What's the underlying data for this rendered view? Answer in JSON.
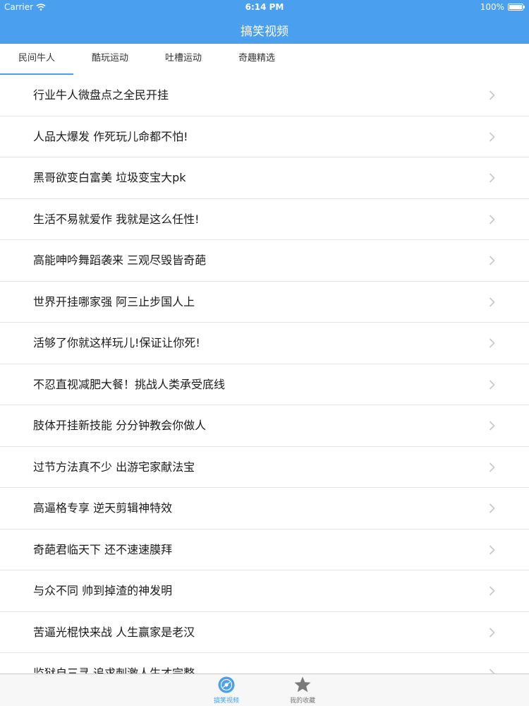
{
  "status_bar": {
    "carrier": "Carrier",
    "time": "6:14 PM",
    "battery": "100%"
  },
  "nav": {
    "title": "搞笑视频"
  },
  "tabs": [
    {
      "label": "民间牛人",
      "active": true
    },
    {
      "label": "酷玩运动",
      "active": false
    },
    {
      "label": "吐槽运动",
      "active": false
    },
    {
      "label": "奇趣精选",
      "active": false
    }
  ],
  "list": {
    "items": [
      "行业牛人微盘点之全民开挂",
      "人品大爆发 作死玩儿命都不怕!",
      "黑哥欲变白富美 垃圾变宝大pk",
      "生活不易就爱作 我就是这么任性!",
      "高能呻吟舞蹈袭来 三观尽毁皆奇葩",
      "世界开挂哪家强 阿三止步国人上",
      "活够了你就这样玩儿!保证让你死!",
      "不忍直视减肥大餐！挑战人类承受底线",
      "肢体开挂新技能 分分钟教会你做人",
      "过节方法真不少 出游宅家献法宝",
      "高逼格专享 逆天剪辑神特效",
      "奇葩君临天下 还不速速膜拜",
      "与众不同 帅到掉渣的神发明",
      "苦逼光棍快来战 人生赢家是老汉",
      "监狱自三寻 追求刺激人生才完整"
    ]
  },
  "tabbar": {
    "items": [
      {
        "label": "搞笑视频",
        "icon": "video-disc-icon",
        "active": true
      },
      {
        "label": "我的收藏",
        "icon": "star-icon",
        "active": false
      }
    ]
  },
  "colors": {
    "accent": "#4a9fee",
    "inactive": "#7a7a7a"
  }
}
